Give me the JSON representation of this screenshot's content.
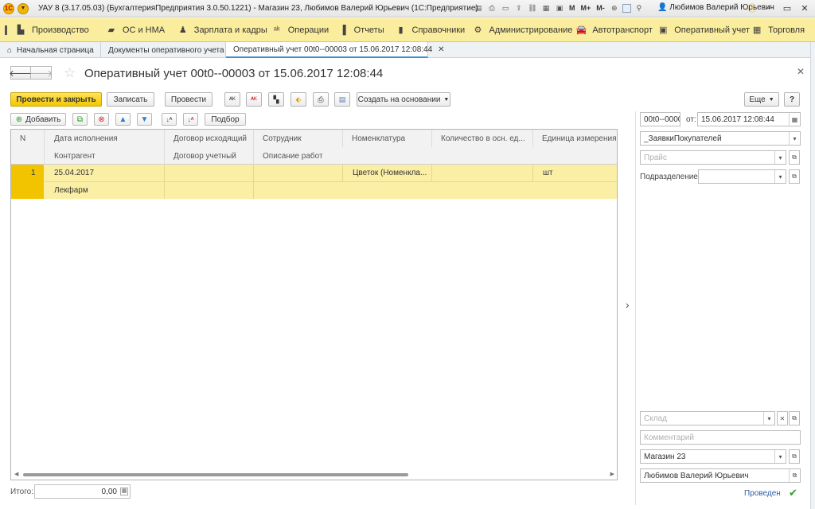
{
  "window": {
    "title": "УАУ 8 (3.17.05.03) (БухгалтерияПредприятия 3.0.50.1221) - Магазин 23, Любимов Валерий Юрьевич  (1С:Предприятие)",
    "user": "Любимов Валерий Юрьевич",
    "tools": [
      "M",
      "M+",
      "M-"
    ]
  },
  "sections": [
    {
      "label": "Производство",
      "icon": "factory-icon"
    },
    {
      "label": "ОС и НМА",
      "icon": "truck-icon"
    },
    {
      "label": "Зарплата и кадры",
      "icon": "person-icon"
    },
    {
      "label": "Операции",
      "icon": "operations-icon"
    },
    {
      "label": "Отчеты",
      "icon": "chart-icon"
    },
    {
      "label": "Справочники",
      "icon": "book-icon"
    },
    {
      "label": "Администрирование",
      "icon": "gear-icon"
    },
    {
      "label": "Автотранспорт",
      "icon": "car-icon"
    },
    {
      "label": "Оперативный учет",
      "icon": "monitor-icon"
    },
    {
      "label": "Торговля",
      "icon": "cash-register-icon"
    }
  ],
  "open_tabs": [
    {
      "label": "Начальная страница"
    },
    {
      "label": "Документы оперативного учета"
    },
    {
      "label": "Оперативный учет 00t0--00003 от 15.06.2017 12:08:44"
    }
  ],
  "form": {
    "title": "Оперативный учет 00t0--00003 от 15.06.2017 12:08:44"
  },
  "commands": {
    "post_close": "Провести и закрыть",
    "save": "Записать",
    "post": "Провести",
    "create_based": "Создать на основании",
    "more": "Еще",
    "help": "?"
  },
  "table_toolbar": {
    "add": "Добавить",
    "pick": "Подбор"
  },
  "table": {
    "headers_row1": [
      "N",
      "Дата исполнения",
      "Договор исходящий",
      "Сотрудник",
      "Номенклатура",
      "Количество в осн. ед...",
      "Единица измерения"
    ],
    "headers_row2": [
      "Контрагент",
      "Договор учетный",
      "Описание работ"
    ],
    "rows": [
      {
        "n": "1",
        "date": "25.04.2017",
        "nomenclature": "Цветок (Номенкла...",
        "unit": "шт",
        "counterparty": "Лекфарм"
      }
    ]
  },
  "total": {
    "label": "Итого:",
    "value": "0,00"
  },
  "right_panel": {
    "number": "00t0--00003",
    "date_label": "от:",
    "date": "15.06.2017 12:08:44",
    "operation": "_ЗаявкиПокупателей",
    "price_placeholder": "Прайс",
    "department_label": "Подразделение:",
    "warehouse_placeholder": "Склад",
    "comment_placeholder": "Комментарий",
    "organization": "Магазин 23",
    "responsible": "Любимов Валерий Юрьевич",
    "status": "Проведен"
  },
  "colors": {
    "section_bar": "#fbed9e",
    "primary_button": "#f2c700",
    "selected_row": "#fbefa6",
    "accent_tab": "#3a8fcf",
    "posted_text": "#2f5fa8",
    "check": "#2c9b2c"
  }
}
